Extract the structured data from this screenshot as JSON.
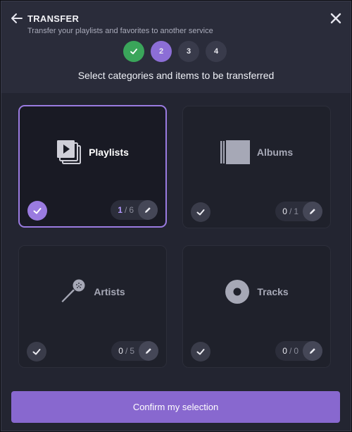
{
  "header": {
    "title": "TRANSFER",
    "subtitle": "Transfer your playlists and favorites to another service"
  },
  "steps": [
    {
      "label": "",
      "state": "done",
      "icon": "check-icon"
    },
    {
      "label": "2",
      "state": "active"
    },
    {
      "label": "3",
      "state": "upcoming"
    },
    {
      "label": "4",
      "state": "upcoming"
    }
  ],
  "prompt": "Select categories and items to be transferred",
  "categories": [
    {
      "label": "Playlists",
      "icon": "playlists-icon",
      "selected_count": "1",
      "separator": "/",
      "total_count": "6",
      "selected": true
    },
    {
      "label": "Albums",
      "icon": "album-icon",
      "selected_count": "0",
      "separator": "/",
      "total_count": "1",
      "selected": false
    },
    {
      "label": "Artists",
      "icon": "microphone-icon",
      "selected_count": "0",
      "separator": "/",
      "total_count": "5",
      "selected": false
    },
    {
      "label": "Tracks",
      "icon": "disc-icon",
      "selected_count": "0",
      "separator": "/",
      "total_count": "0",
      "selected": false
    }
  ],
  "confirm_label": "Confirm my selection",
  "colors": {
    "accent": "#8868cf",
    "step_done": "#3aa55a",
    "background": "#232531"
  }
}
